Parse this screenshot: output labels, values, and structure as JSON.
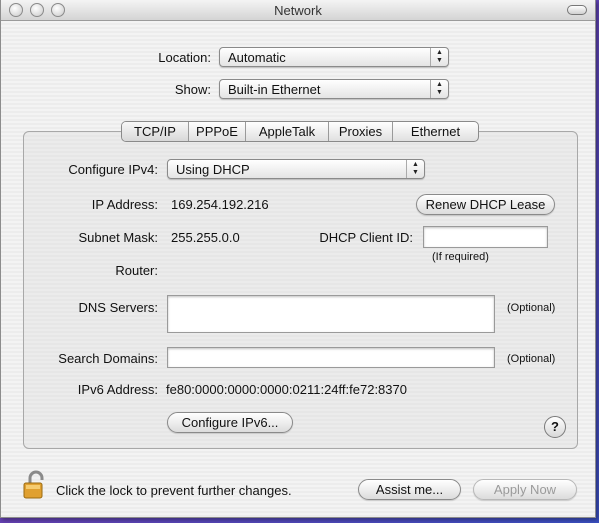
{
  "window": {
    "title": "Network"
  },
  "location": {
    "label": "Location:",
    "value": "Automatic"
  },
  "show": {
    "label": "Show:",
    "value": "Built-in Ethernet"
  },
  "tabs": [
    {
      "label": "TCP/IP",
      "selected": true
    },
    {
      "label": "PPPoE"
    },
    {
      "label": "AppleTalk"
    },
    {
      "label": "Proxies"
    },
    {
      "label": "Ethernet"
    }
  ],
  "configure_ipv4": {
    "label": "Configure IPv4:",
    "value": "Using DHCP"
  },
  "ip_address": {
    "label": "IP Address:",
    "value": "169.254.192.216"
  },
  "renew_button": "Renew DHCP Lease",
  "subnet_mask": {
    "label": "Subnet Mask:",
    "value": "255.255.0.0"
  },
  "dhcp_client_id": {
    "label": "DHCP Client ID:",
    "value": "",
    "hint": "(If required)"
  },
  "router": {
    "label": "Router:",
    "value": ""
  },
  "dns_servers": {
    "label": "DNS Servers:",
    "value": "",
    "hint": "(Optional)"
  },
  "search_domains": {
    "label": "Search Domains:",
    "value": "",
    "hint": "(Optional)"
  },
  "ipv6_address": {
    "label": "IPv6 Address:",
    "value": "fe80:0000:0000:0000:0211:24ff:fe72:8370"
  },
  "configure_ipv6_button": "Configure IPv6...",
  "help_button": "?",
  "lock_text": "Click the lock to prevent further changes.",
  "assist_button": "Assist me...",
  "apply_button": "Apply Now",
  "icons": {
    "lock": "lock-icon",
    "help": "help-icon"
  }
}
